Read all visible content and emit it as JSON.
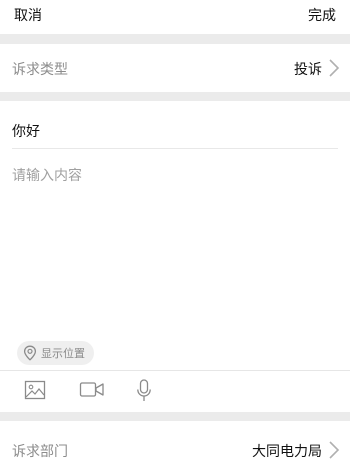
{
  "header": {
    "cancel_label": "取消",
    "done_label": "完成"
  },
  "appeal_type": {
    "label": "诉求类型",
    "value": "投诉"
  },
  "content": {
    "title_value": "你好",
    "body_placeholder": "请输入内容",
    "location_label": "显示位置"
  },
  "toolbar": {
    "icons": [
      "image-icon",
      "video-icon",
      "microphone-icon"
    ]
  },
  "department": {
    "label": "诉求部门",
    "value": "大同电力局"
  },
  "colors": {
    "separator": "#ebebeb",
    "label_gray": "#8c8c8c",
    "placeholder_gray": "#a0a0a0",
    "pill_bg": "#efefef"
  }
}
